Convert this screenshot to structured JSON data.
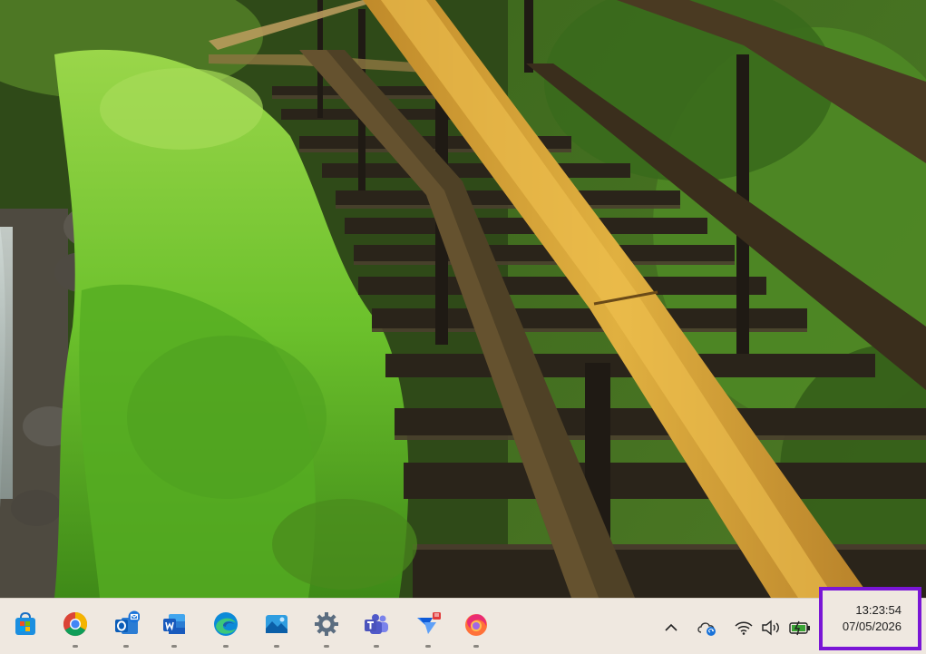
{
  "desktop": {
    "wallpaper": "wooden-staircase-forest"
  },
  "taskbar": {
    "apps": [
      {
        "name": "microsoft-store",
        "icon": "store-icon"
      },
      {
        "name": "google-chrome",
        "icon": "chrome-icon"
      },
      {
        "name": "outlook",
        "icon": "outlook-icon"
      },
      {
        "name": "word",
        "icon": "word-icon"
      },
      {
        "name": "microsoft-edge",
        "icon": "edge-icon"
      },
      {
        "name": "photos",
        "icon": "photos-icon"
      },
      {
        "name": "settings",
        "icon": "gear-icon"
      },
      {
        "name": "teams",
        "icon": "teams-icon"
      },
      {
        "name": "power-automate",
        "icon": "power-automate-icon"
      },
      {
        "name": "firefox",
        "icon": "firefox-icon"
      }
    ],
    "tray": {
      "chevron_icon": "chevron-up-icon",
      "sync_icon": "cloud-sync-icon",
      "wifi_icon": "wifi-icon",
      "volume_icon": "volume-icon",
      "battery_icon": "battery-charging-icon"
    },
    "clock": {
      "time": "13:23:54",
      "date": "07/05/2026"
    },
    "colors": {
      "taskbar_bg": "#efe8e0",
      "clock_highlight": "#7a16d6"
    }
  }
}
